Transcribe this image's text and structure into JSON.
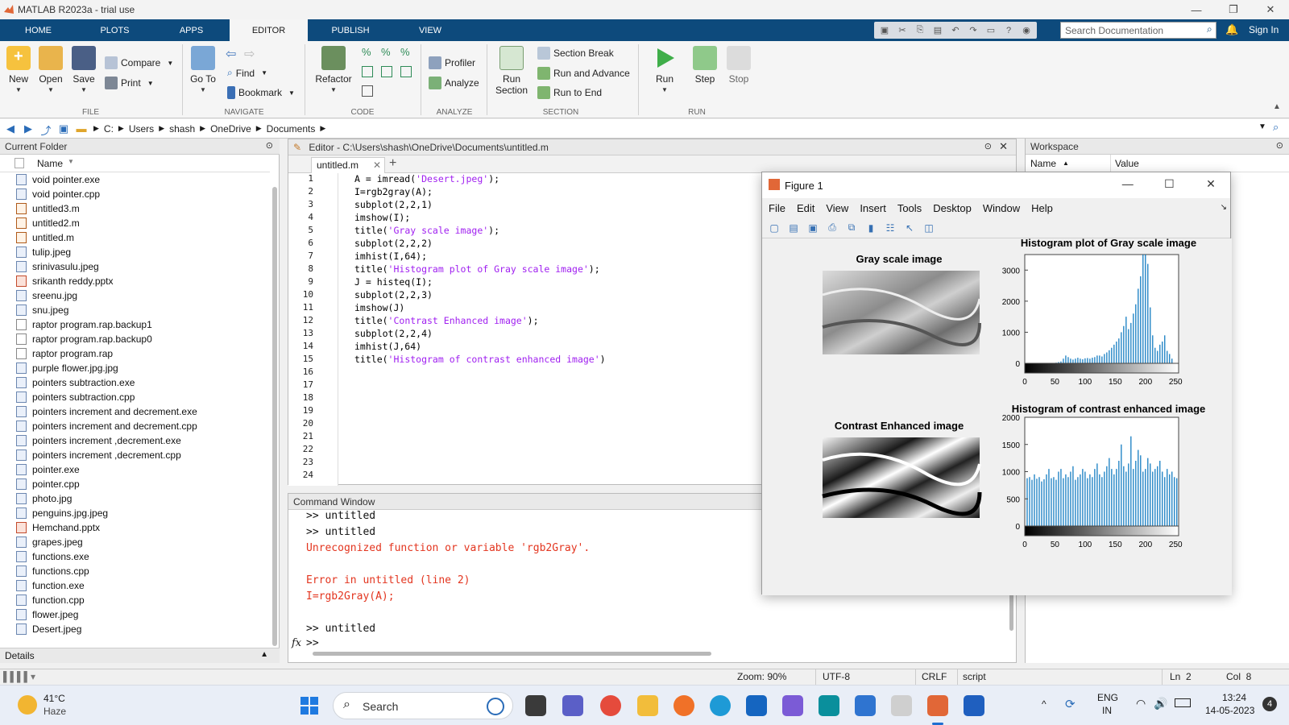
{
  "window": {
    "title": "MATLAB R2023a - trial use",
    "controls": [
      "—",
      "❐",
      "✕"
    ]
  },
  "ribbon_tabs": [
    "HOME",
    "PLOTS",
    "APPS",
    "EDITOR",
    "PUBLISH",
    "VIEW"
  ],
  "active_tab": "EDITOR",
  "search": {
    "placeholder": "Search Documentation"
  },
  "sign_in": "Sign In",
  "ribbon": {
    "file": {
      "label": "FILE",
      "new": "New",
      "open": "Open",
      "save": "Save",
      "compare": "Compare",
      "print": "Print"
    },
    "navigate": {
      "label": "NAVIGATE",
      "goto": "Go To",
      "find": "Find",
      "bookmark": "Bookmark"
    },
    "code": {
      "label": "CODE",
      "refactor": "Refactor"
    },
    "analyze": {
      "label": "ANALYZE",
      "profiler": "Profiler",
      "analyze": "Analyze"
    },
    "section": {
      "label": "SECTION",
      "run_section_1": "Run",
      "run_section_2": "Section",
      "section_break": "Section Break",
      "run_advance": "Run and Advance",
      "run_end": "Run to End"
    },
    "run": {
      "label": "RUN",
      "run": "Run",
      "step": "Step",
      "stop": "Stop"
    }
  },
  "address": [
    "C:",
    "Users",
    "shash",
    "OneDrive",
    "Documents"
  ],
  "current_folder": {
    "title": "Current Folder",
    "column": "Name",
    "files": [
      {
        "name": "void pointer.exe",
        "kind": "exe"
      },
      {
        "name": "void pointer.cpp",
        "kind": "cpp"
      },
      {
        "name": "untitled3.m",
        "kind": "m"
      },
      {
        "name": "untitled2.m",
        "kind": "m"
      },
      {
        "name": "untitled.m",
        "kind": "m"
      },
      {
        "name": "tulip.jpeg",
        "kind": "img"
      },
      {
        "name": "srinivasulu.jpeg",
        "kind": "img"
      },
      {
        "name": "srikanth reddy.pptx",
        "kind": "ppt"
      },
      {
        "name": "sreenu.jpg",
        "kind": "img"
      },
      {
        "name": "snu.jpeg",
        "kind": "img"
      },
      {
        "name": "raptor program.rap.backup1",
        "kind": "plain"
      },
      {
        "name": "raptor program.rap.backup0",
        "kind": "plain"
      },
      {
        "name": "raptor program.rap",
        "kind": "plain"
      },
      {
        "name": "purple flower.jpg.jpg",
        "kind": "img"
      },
      {
        "name": "pointers subtraction.exe",
        "kind": "exe"
      },
      {
        "name": "pointers subtraction.cpp",
        "kind": "cpp"
      },
      {
        "name": "pointers increment and decrement.exe",
        "kind": "exe"
      },
      {
        "name": "pointers increment and decrement.cpp",
        "kind": "cpp"
      },
      {
        "name": "pointers increment ,decrement.exe",
        "kind": "exe"
      },
      {
        "name": "pointers increment ,decrement.cpp",
        "kind": "cpp"
      },
      {
        "name": "pointer.exe",
        "kind": "exe"
      },
      {
        "name": "pointer.cpp",
        "kind": "cpp"
      },
      {
        "name": "photo.jpg",
        "kind": "img"
      },
      {
        "name": "penguins.jpg.jpeg",
        "kind": "img"
      },
      {
        "name": "Hemchand.pptx",
        "kind": "ppt"
      },
      {
        "name": "grapes.jpeg",
        "kind": "img"
      },
      {
        "name": "functions.exe",
        "kind": "exe"
      },
      {
        "name": "functions.cpp",
        "kind": "cpp"
      },
      {
        "name": "function.exe",
        "kind": "exe"
      },
      {
        "name": "function.cpp",
        "kind": "cpp"
      },
      {
        "name": "flower.jpeg",
        "kind": "img"
      },
      {
        "name": "Desert.jpeg",
        "kind": "img"
      }
    ],
    "details": "Details"
  },
  "editor": {
    "title": "Editor - C:\\Users\\shash\\OneDrive\\Documents\\untitled.m",
    "tab": "untitled.m",
    "lines": [
      {
        "pre": "A = imread(",
        "str": "'Desert.jpeg'",
        "post": ");"
      },
      {
        "pre": "I=rgb2gray(A);",
        "str": "",
        "post": ""
      },
      {
        "pre": "subplot(2,2,1)",
        "str": "",
        "post": ""
      },
      {
        "pre": "imshow(I);",
        "str": "",
        "post": ""
      },
      {
        "pre": "title(",
        "str": "'Gray scale image'",
        "post": ");"
      },
      {
        "pre": "subplot(2,2,2)",
        "str": "",
        "post": ""
      },
      {
        "pre": "imhist(I,64);",
        "str": "",
        "post": ""
      },
      {
        "pre": "title(",
        "str": "'Histogram plot of Gray scale image'",
        "post": ");"
      },
      {
        "pre": "J = histeq(I);",
        "str": "",
        "post": ""
      },
      {
        "pre": "subplot(2,2,3)",
        "str": "",
        "post": ""
      },
      {
        "pre": "imshow(J)",
        "str": "",
        "post": ""
      },
      {
        "pre": "title(",
        "str": "'Contrast Enhanced image'",
        "post": ");"
      },
      {
        "pre": "subplot(2,2,4)",
        "str": "",
        "post": ""
      },
      {
        "pre": "imhist(J,64)",
        "str": "",
        "post": ""
      },
      {
        "pre": "title(",
        "str": "'Histogram of contrast enhanced image'",
        "post": ")"
      }
    ],
    "line_count": 24
  },
  "command_window": {
    "title": "Command Window",
    "lines": [
      {
        "text": ">> untitled",
        "kind": "normal"
      },
      {
        "text": ">> untitled",
        "kind": "normal"
      },
      {
        "text": "Unrecognized function or variable 'rgb2Gray'.",
        "kind": "error"
      },
      {
        "text": "",
        "kind": "normal"
      },
      {
        "text": "Error in untitled (line 2)",
        "kind": "errlink"
      },
      {
        "text": "I=rgb2Gray(A);",
        "kind": "error"
      },
      {
        "text": "",
        "kind": "normal"
      },
      {
        "text": ">> untitled",
        "kind": "normal"
      }
    ],
    "prompt": ">>",
    "fx": "fx"
  },
  "workspace": {
    "title": "Workspace",
    "columns": [
      "Name",
      "Value"
    ]
  },
  "figure": {
    "title": "Figure 1",
    "menu": [
      "File",
      "Edit",
      "View",
      "Insert",
      "Tools",
      "Desktop",
      "Window",
      "Help"
    ],
    "subplot_titles": [
      "Gray scale image",
      "Histogram plot of Gray scale image",
      "Contrast Enhanced image",
      "Histogram of contrast enhanced image"
    ]
  },
  "chart_data": [
    {
      "type": "bar",
      "title": "Histogram plot of Gray scale image",
      "xlim": [
        0,
        255
      ],
      "ylim": [
        0,
        3500
      ],
      "xticks": [
        0,
        50,
        100,
        150,
        200,
        250
      ],
      "yticks": [
        0,
        1000,
        2000,
        3000
      ],
      "x": [
        4,
        8,
        12,
        16,
        20,
        24,
        28,
        32,
        36,
        40,
        44,
        48,
        52,
        56,
        60,
        64,
        68,
        72,
        76,
        80,
        84,
        88,
        92,
        96,
        100,
        104,
        108,
        112,
        116,
        120,
        124,
        128,
        132,
        136,
        140,
        144,
        148,
        152,
        156,
        160,
        164,
        168,
        172,
        176,
        180,
        184,
        188,
        192,
        196,
        200,
        204,
        208,
        212,
        216,
        220,
        224,
        228,
        232,
        236,
        240,
        244,
        248,
        252
      ],
      "values": [
        0,
        0,
        0,
        0,
        0,
        0,
        0,
        0,
        0,
        0,
        0,
        0,
        20,
        40,
        60,
        150,
        250,
        200,
        150,
        120,
        150,
        180,
        150,
        130,
        160,
        170,
        150,
        180,
        200,
        250,
        250,
        220,
        300,
        350,
        420,
        500,
        600,
        700,
        800,
        1000,
        1200,
        1500,
        1100,
        1300,
        1600,
        1900,
        2400,
        2800,
        3500,
        3500,
        3200,
        1800,
        900,
        500,
        400,
        600,
        700,
        900,
        400,
        300,
        150,
        0,
        0
      ]
    },
    {
      "type": "bar",
      "title": "Histogram of contrast enhanced image",
      "xlim": [
        0,
        255
      ],
      "ylim": [
        0,
        2000
      ],
      "xticks": [
        0,
        50,
        100,
        150,
        200,
        250
      ],
      "yticks": [
        0,
        500,
        1000,
        1500,
        2000
      ],
      "x": [
        4,
        8,
        12,
        16,
        20,
        24,
        28,
        32,
        36,
        40,
        44,
        48,
        52,
        56,
        60,
        64,
        68,
        72,
        76,
        80,
        84,
        88,
        92,
        96,
        100,
        104,
        108,
        112,
        116,
        120,
        124,
        128,
        132,
        136,
        140,
        144,
        148,
        152,
        156,
        160,
        164,
        168,
        172,
        176,
        180,
        184,
        188,
        192,
        196,
        200,
        204,
        208,
        212,
        216,
        220,
        224,
        228,
        232,
        236,
        240,
        244,
        248,
        252
      ],
      "values": [
        880,
        900,
        850,
        950,
        870,
        900,
        820,
        860,
        950,
        1050,
        880,
        900,
        850,
        1000,
        1050,
        880,
        950,
        900,
        1000,
        1100,
        850,
        900,
        950,
        1050,
        1000,
        880,
        950,
        900,
        1050,
        1150,
        950,
        900,
        1000,
        1100,
        1250,
        1050,
        950,
        1050,
        1200,
        1500,
        1100,
        1000,
        1150,
        1650,
        1050,
        1200,
        1400,
        1300,
        1000,
        1050,
        1250,
        1150,
        1000,
        1050,
        1100,
        1200,
        1000,
        900,
        1050,
        950,
        1000,
        900,
        880
      ]
    }
  ],
  "statusbar": {
    "zoom": "Zoom: 90%",
    "encoding": "UTF-8",
    "eol": "CRLF",
    "type": "script",
    "ln": "Ln  2",
    "col": "Col  8"
  },
  "taskbar": {
    "weather_temp": "41°C",
    "weather_desc": "Haze",
    "search": "Search",
    "lang_1": "ENG",
    "lang_2": "IN",
    "time": "13:24",
    "date": "14-05-2023",
    "badge": "4"
  }
}
